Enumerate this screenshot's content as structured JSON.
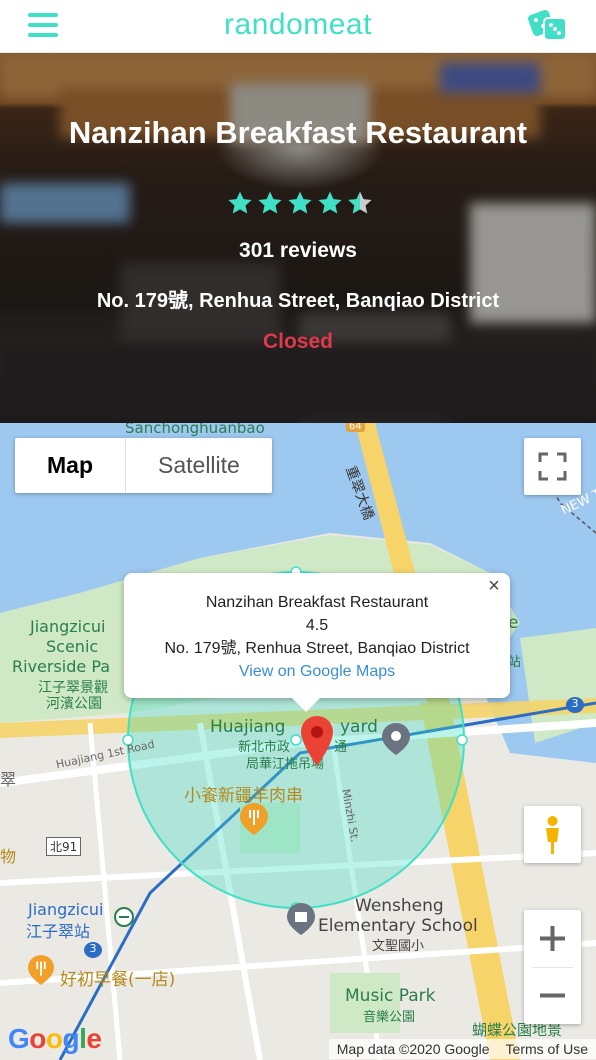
{
  "app": {
    "title": "randomeat"
  },
  "header": {
    "menu_icon": "hamburger-menu-icon",
    "random_icon": "dice-icon",
    "accent": "#3fe0c5"
  },
  "restaurant": {
    "name": "Nanzihan Breakfast Restaurant",
    "rating": 4.5,
    "stars_shown": 5,
    "reviews": "301 reviews",
    "address": "No. 179號, Renhua Street, Banqiao District",
    "status": "Closed",
    "status_color": "#e0394a"
  },
  "map": {
    "type_options": [
      "Map",
      "Satellite"
    ],
    "selected_type": "Map",
    "info_window": {
      "name": "Nanzihan Breakfast Restaurant",
      "rating": "4.5",
      "address": "No. 179號, Renhua Street, Banqiao District",
      "link": "View on Google Maps"
    },
    "labels": {
      "sanchong": "Sanchonghuanbao",
      "bridge": "重翠大橋",
      "jiangzicui_1": "Jiangzicui",
      "jiangzicui_2": "Scenic",
      "jiangzicui_3": "Riverside Pa",
      "jiangzicui_zh1": "江子翠景觀",
      "jiangzicui_zh2": "河濱公園",
      "huajiang_road": "Huajiang 1st Road",
      "huajiang_yard": "Huajiang",
      "yard": "yard",
      "huajiang_zh1": "新北市政",
      "huajiang_zh1b": "通",
      "huajiang_zh2": "局華江拖吊場",
      "restaurant_zh": "小餈新疆羊肉串",
      "minzhi": "Minzhi St.",
      "station_en": "Jiangzicui",
      "station_zh": "江子翠站",
      "wensheng_1": "Wensheng",
      "wensheng_2": "Elementary School",
      "wensheng_zh": "文聖國小",
      "breakfast_zh": "好初早餐(一店)",
      "music_park": "Music Park",
      "music_park_zh": "音樂公園",
      "butterfly_zh": "蝴蝶公園地景",
      "new_taipei": "NEW T",
      "zh_cui": "翠",
      "zh_wu": "物",
      "zh_zhan": "站",
      "letter_e": "e",
      "road_64": "64",
      "road_3a": "3",
      "road_3b": "3",
      "road_bei": "北91"
    },
    "attribution": "Map data ©2020 Google",
    "terms": "Terms of Use",
    "logo": "Google"
  }
}
